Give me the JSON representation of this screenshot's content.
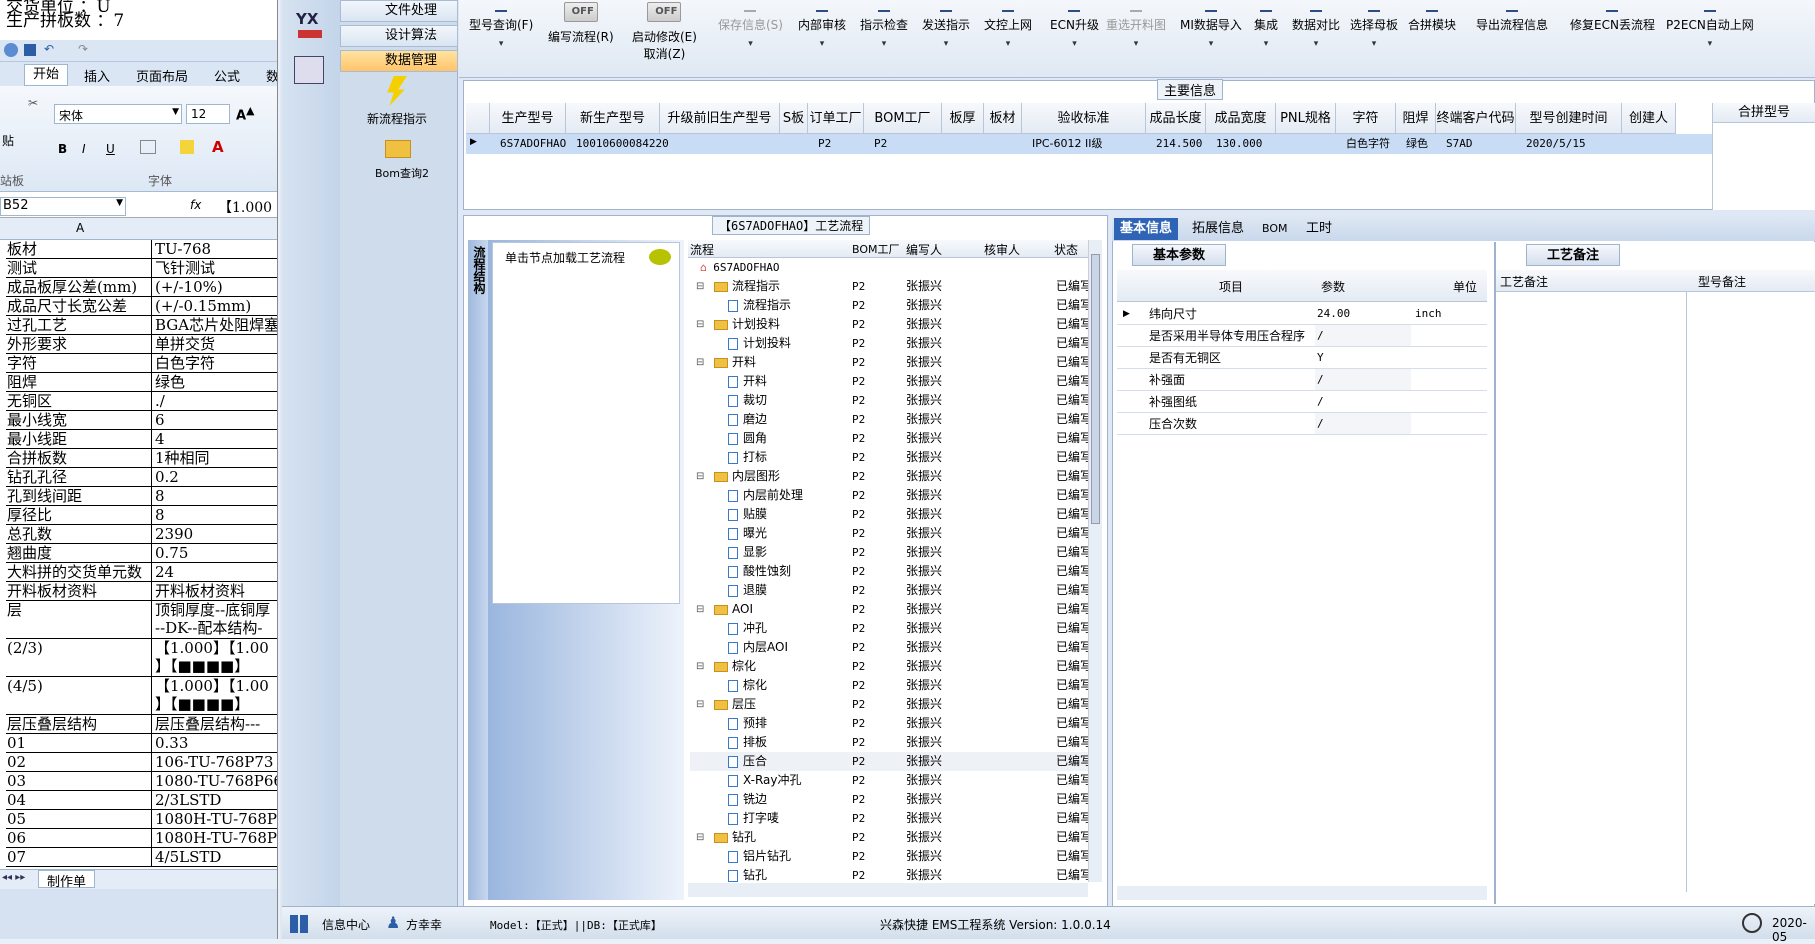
{
  "excel": {
    "head_line1": "交货单位 ：U",
    "head_line2": "生产拼板数 ：7",
    "tabs": [
      "开始",
      "插入",
      "页面布局",
      "公式",
      "数"
    ],
    "font_name": "宋体",
    "font_size": "12",
    "group_clipboard": "站板",
    "group_font": "字体",
    "paste_label": "贴",
    "cell_ref": "B52",
    "fx": "fx",
    "formula": "【1.000",
    "col_a": "A",
    "rows": [
      [
        "板材",
        "TU-768"
      ],
      [
        "测试",
        "飞针测试"
      ],
      [
        "成品板厚公差(mm)",
        "(+/-10%)"
      ],
      [
        "成品尺寸长宽公差",
        "(+/-0.15mm)"
      ],
      [
        "过孔工艺",
        "BGA芯片处阻焊塞"
      ],
      [
        "外形要求",
        "单拼交货"
      ],
      [
        "字符",
        "白色字符"
      ],
      [
        "阻焊",
        "绿色"
      ],
      [
        "无铜区",
        "./"
      ],
      [
        "最小线宽",
        "6"
      ],
      [
        "最小线距",
        "4"
      ],
      [
        "合拼板数",
        "1种相同"
      ],
      [
        "钻孔孔径",
        "0.2"
      ],
      [
        "孔到线间距",
        "8"
      ],
      [
        "厚径比",
        "8"
      ],
      [
        "总孔数",
        "2390"
      ],
      [
        "翘曲度",
        "0.75"
      ],
      [
        "大料拼的交货单元数",
        "24"
      ],
      [
        "开料板材资料",
        "开料板材资料"
      ]
    ],
    "layer_label": "层",
    "layer_val1": "顶铜厚度--底铜厚",
    "layer_val2": "--DK--配本结构-",
    "r23": "(2/3)",
    "r45": "(4/5)",
    "bracket_val": "【1.000】【1.00",
    "bracket_blocks": "】【■■■■】",
    "rows2": [
      [
        "层压叠层结构",
        "层压叠层结构---"
      ],
      [
        "01",
        "0.33"
      ],
      [
        "02",
        "106-TU-768P73"
      ],
      [
        "03",
        "1080-TU-768P66"
      ],
      [
        "04",
        "2/3LSTD"
      ],
      [
        "05",
        "1080H-TU-768P71"
      ],
      [
        "06",
        "1080H-TU-768P71"
      ],
      [
        "07",
        "4/5LSTD"
      ]
    ],
    "sheet_tab": "制作单"
  },
  "nav": {
    "logo": "YX",
    "items": [
      {
        "label": "文件处理"
      },
      {
        "label": "设计算法"
      },
      {
        "label": "数据管理"
      }
    ],
    "new_flow": "新流程指示",
    "bom_query": "Bom查询2"
  },
  "toolbar": [
    {
      "label": "型号查询(F)",
      "dis": false
    },
    {
      "label": "编写流程(R)",
      "dis": false,
      "toggle": "OFF"
    },
    {
      "label": "启动修改(E)",
      "label2": "取消(Z)",
      "dis": false,
      "toggle": "OFF"
    },
    {
      "label": "保存信息(S)",
      "dis": true
    },
    {
      "label": "内部审核",
      "dis": false
    },
    {
      "label": "指示检查",
      "dis": false
    },
    {
      "label": "发送指示",
      "dis": false
    },
    {
      "label": "文控上网",
      "dis": false
    },
    {
      "label": "ECN升级",
      "dis": false
    },
    {
      "label": "重选开料图",
      "dis": true
    },
    {
      "label": "MI数据导入",
      "dis": false
    },
    {
      "label": "集成",
      "dis": false
    },
    {
      "label": "数据对比",
      "dis": false
    },
    {
      "label": "选择母板",
      "dis": false
    },
    {
      "label": "合拼模块",
      "dis": false
    },
    {
      "label": "导出流程信息",
      "dis": false
    },
    {
      "label": "修复ECN丢流程",
      "dis": false
    },
    {
      "label": "P2ECN自动上网",
      "dis": false
    }
  ],
  "main_info": {
    "title": "主要信息",
    "headers": [
      "生产型号",
      "新生产型号",
      "升级前旧生产型号",
      "S板",
      "订单工厂",
      "BOM工厂",
      "板厚",
      "板材",
      "验收标准",
      "成品长度",
      "成品宽度",
      "PNL规格",
      "字符",
      "阻焊",
      "终端客户代码",
      "型号创建时间",
      "创建人"
    ],
    "row": [
      "6S7ADOFHAO",
      "10010600084220",
      "",
      "",
      "P2",
      "P2",
      "",
      "",
      "IPC-6012 II级",
      "214.500",
      "130.000",
      "",
      "白色字符",
      "绿色",
      "S7AD",
      "2020/5/15",
      ""
    ],
    "merge_header": "合拼型号"
  },
  "flow": {
    "title": "【6S7ADOFHAO】工艺流程",
    "side_tab": "流程结构",
    "click_hint": "单击节点加载工艺流程",
    "cols": [
      "流程",
      "BOM工厂",
      "编写人",
      "核审人",
      "状态"
    ],
    "root": "6S7ADOFHAO",
    "nodes": [
      {
        "n": "流程指示",
        "f": 1
      },
      {
        "n": "流程指示",
        "f": 0
      },
      {
        "n": "计划投料",
        "f": 1
      },
      {
        "n": "计划投料",
        "f": 0
      },
      {
        "n": "开料",
        "f": 1
      },
      {
        "n": "开料",
        "f": 0
      },
      {
        "n": "裁切",
        "f": 0
      },
      {
        "n": "磨边",
        "f": 0
      },
      {
        "n": "圆角",
        "f": 0
      },
      {
        "n": "打标",
        "f": 0
      },
      {
        "n": "内层图形",
        "f": 1
      },
      {
        "n": "内层前处理",
        "f": 0
      },
      {
        "n": "贴膜",
        "f": 0
      },
      {
        "n": "曝光",
        "f": 0
      },
      {
        "n": "显影",
        "f": 0
      },
      {
        "n": "酸性蚀刻",
        "f": 0
      },
      {
        "n": "退膜",
        "f": 0
      },
      {
        "n": "AOI",
        "f": 1
      },
      {
        "n": "冲孔",
        "f": 0
      },
      {
        "n": "内层AOI",
        "f": 0
      },
      {
        "n": "棕化",
        "f": 1
      },
      {
        "n": "棕化",
        "f": 0
      },
      {
        "n": "层压",
        "f": 1
      },
      {
        "n": "预排",
        "f": 0
      },
      {
        "n": "排板",
        "f": 0
      },
      {
        "n": "压合",
        "f": 0
      },
      {
        "n": "X-Ray冲孔",
        "f": 0
      },
      {
        "n": "铣边",
        "f": 0
      },
      {
        "n": "打字唛",
        "f": 0
      },
      {
        "n": "钻孔",
        "f": 1
      },
      {
        "n": "铝片钻孔",
        "f": 0
      },
      {
        "n": "钻孔",
        "f": 0
      }
    ],
    "factory": "P2",
    "author": "张振兴",
    "status": "已编写"
  },
  "right": {
    "tabs": [
      "基本信息",
      "拓展信息",
      "BOM",
      "工时"
    ],
    "sub_tab": "基本参数",
    "cols": [
      "项目",
      "参数",
      "单位"
    ],
    "params": [
      [
        "纬向尺寸",
        "24.00",
        "inch"
      ],
      [
        "是否采用半导体专用压合程序",
        "/",
        ""
      ],
      [
        "是否有无铜区",
        "Y",
        ""
      ],
      [
        "补强面",
        "/",
        ""
      ],
      [
        "补强图纸",
        "/",
        ""
      ],
      [
        "压合次数",
        "/",
        ""
      ]
    ],
    "note_tab": "工艺备注",
    "note_cols": [
      "工艺备注",
      "型号备注"
    ]
  },
  "status": {
    "info_center": "信息中心",
    "user": "方幸幸",
    "model": "Model:【正式】||DB:【正式库】",
    "app": "兴森快捷 EMS工程系统 Version: 1.0.0.14",
    "date": "2020-05"
  }
}
